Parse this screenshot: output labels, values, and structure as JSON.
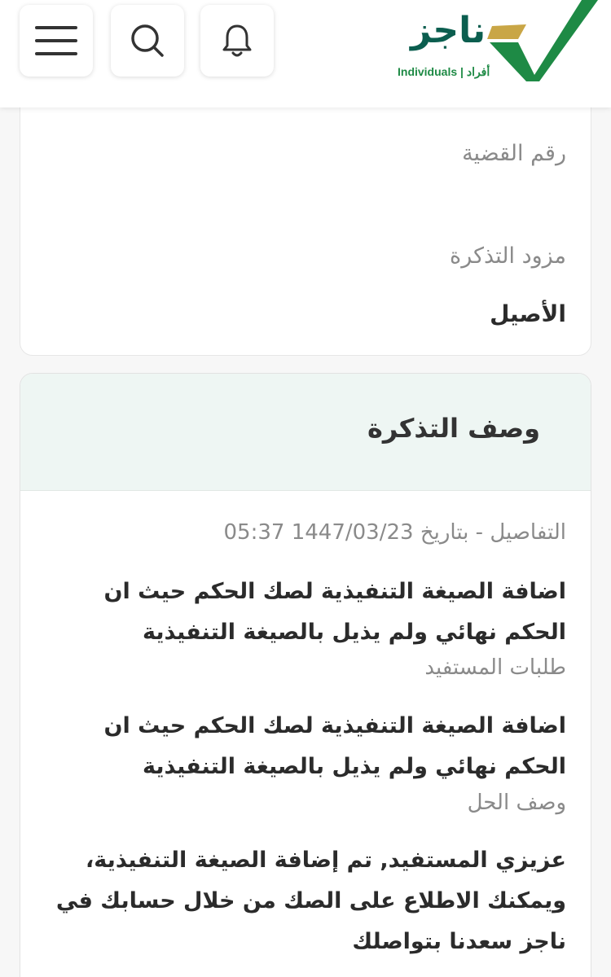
{
  "brand": {
    "name_ar": "ناجز",
    "subtitle": "Individuals | أفراد",
    "colors": {
      "primary_green": "#1e8a45",
      "dark_green": "#0b5e4f",
      "gold": "#c9a646"
    }
  },
  "header": {
    "icons": {
      "menu": "menu-icon",
      "search": "search-icon",
      "notifications": "bell-icon"
    }
  },
  "case_card": {
    "case_number_label": "رقم القضية",
    "case_number_value": "",
    "provider_label": "مزود التذكرة",
    "provider_value": "الأصيل"
  },
  "ticket_description": {
    "title": "وصف التذكرة",
    "details_meta": "التفاصيل - بتاريخ 1447/03/23 05:37",
    "details_text": "اضافة الصيغة التنفيذية لصك الحكم حيث ان الحكم نهائي ولم يذيل بالصيغة التنفيذية",
    "requests_label": "طلبات المستفيد",
    "requests_text": "اضافة الصيغة التنفيذية لصك الحكم حيث ان الحكم نهائي ولم يذيل بالصيغة التنفيذية",
    "solution_label": "وصف الحل",
    "solution_text": "عزيزي المستفيد, تم إضافة الصيغة التنفيذية، ويمكنك الاطلاع على الصك من خلال حسابك في ناجز سعدنا بتواصلك"
  }
}
